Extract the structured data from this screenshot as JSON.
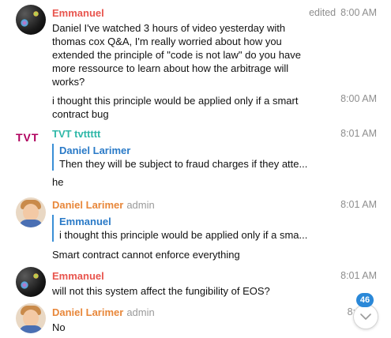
{
  "messages": [
    {
      "sender": "Emmanuel",
      "sender_color": "#e8554e",
      "status": "edited",
      "time": "8:00 AM",
      "text": "Daniel I've watched 3 hours of video yesterday with thomas cox Q&A, I'm really worried about how you extended the principle of \"code is not law\" do you have more ressource to learn about how the arbitrage will works?"
    },
    {
      "time": "8:00 AM",
      "text": "i thought this principle would be applied only if a smart contract bug"
    },
    {
      "sender": "TVT tvttttt",
      "sender_color": "#2fb8a8",
      "avatar_text": "TVT",
      "time": "8:01 AM",
      "reply_to": {
        "name": "Daniel Larimer",
        "text": "Then they will be subject to fraud charges if they atte..."
      },
      "text": "he"
    },
    {
      "sender": "Daniel Larimer",
      "sender_color": "#e8873a",
      "role": "admin",
      "time": "8:01 AM",
      "reply_to": {
        "name": "Emmanuel",
        "text": "i thought this principle would be applied only if a sma..."
      },
      "text": "Smart contract cannot enforce everything"
    },
    {
      "sender": "Emmanuel",
      "sender_color": "#e8554e",
      "time": "8:01 AM",
      "text": "will not this system affect the fungibility of EOS?"
    },
    {
      "sender": "Daniel Larimer",
      "sender_color": "#e8873a",
      "role": "admin",
      "time": "8:0",
      "text": "No"
    }
  ],
  "unread_badge": "46",
  "icons": {
    "scroll_down": "chevron-down-icon"
  }
}
